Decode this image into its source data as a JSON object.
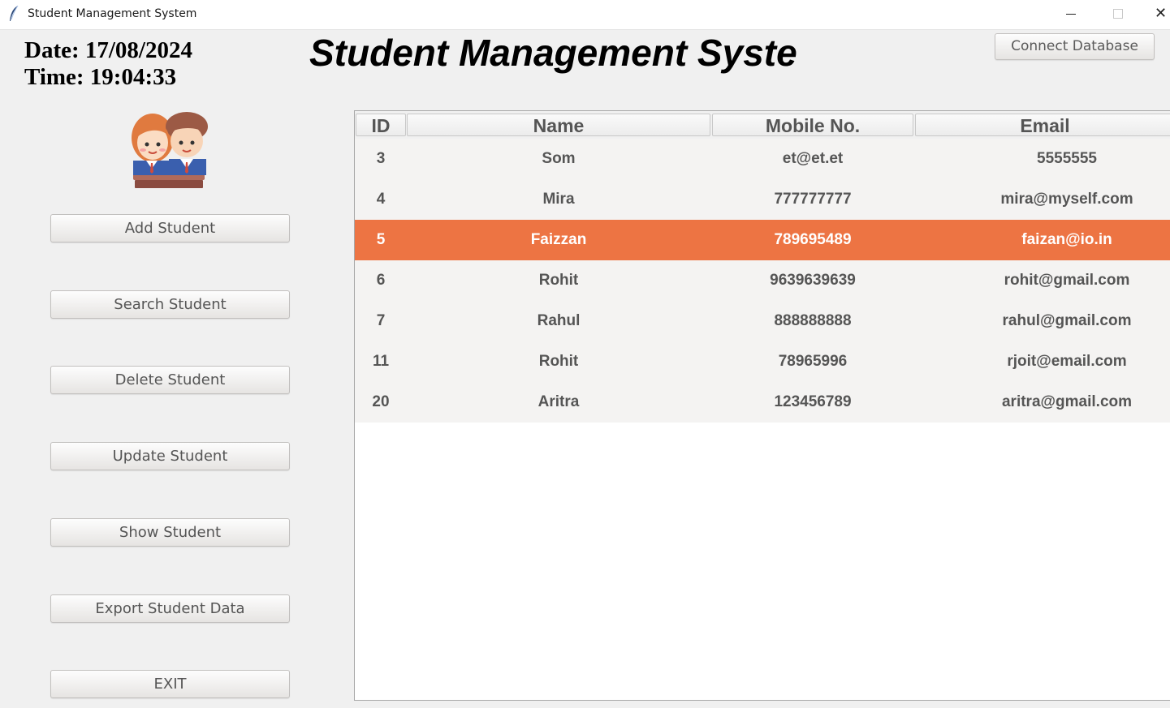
{
  "window": {
    "title": "Student Management System",
    "controls": {
      "minimize": "─",
      "maximize": "☐",
      "close": "✕"
    }
  },
  "clock": {
    "date_line": "Date: 17/08/2024",
    "time_line": "Time: 19:04:33"
  },
  "heading": "Student Management Syste",
  "connect_button": "Connect Database",
  "sidebar": {
    "buttons": [
      {
        "label": "Add Student"
      },
      {
        "label": "Search Student"
      },
      {
        "label": "Delete Student"
      },
      {
        "label": "Update Student"
      },
      {
        "label": "Show Student"
      },
      {
        "label": "Export Student Data"
      },
      {
        "label": "EXIT"
      }
    ]
  },
  "table": {
    "columns": [
      "ID",
      "Name",
      "Mobile No.",
      "Email"
    ],
    "selected_row": 2,
    "selection_color": "#ed7443",
    "rows": [
      [
        "3",
        "Som",
        "et@et.et",
        "5555555"
      ],
      [
        "4",
        "Mira",
        "777777777",
        "mira@myself.com"
      ],
      [
        "5",
        "Faizzan",
        "789695489",
        "faizan@io.in"
      ],
      [
        "6",
        "Rohit",
        "9639639639",
        "rohit@gmail.com"
      ],
      [
        "7",
        "Rahul",
        "888888888",
        "rahul@gmail.com"
      ],
      [
        "11",
        "Rohit",
        "78965996",
        "rjoit@email.com"
      ],
      [
        "20",
        "Aritra",
        "123456789",
        "aritra@gmail.com"
      ]
    ]
  },
  "icons": {
    "app": "feather-icon",
    "avatar": "students-avatar-icon"
  }
}
